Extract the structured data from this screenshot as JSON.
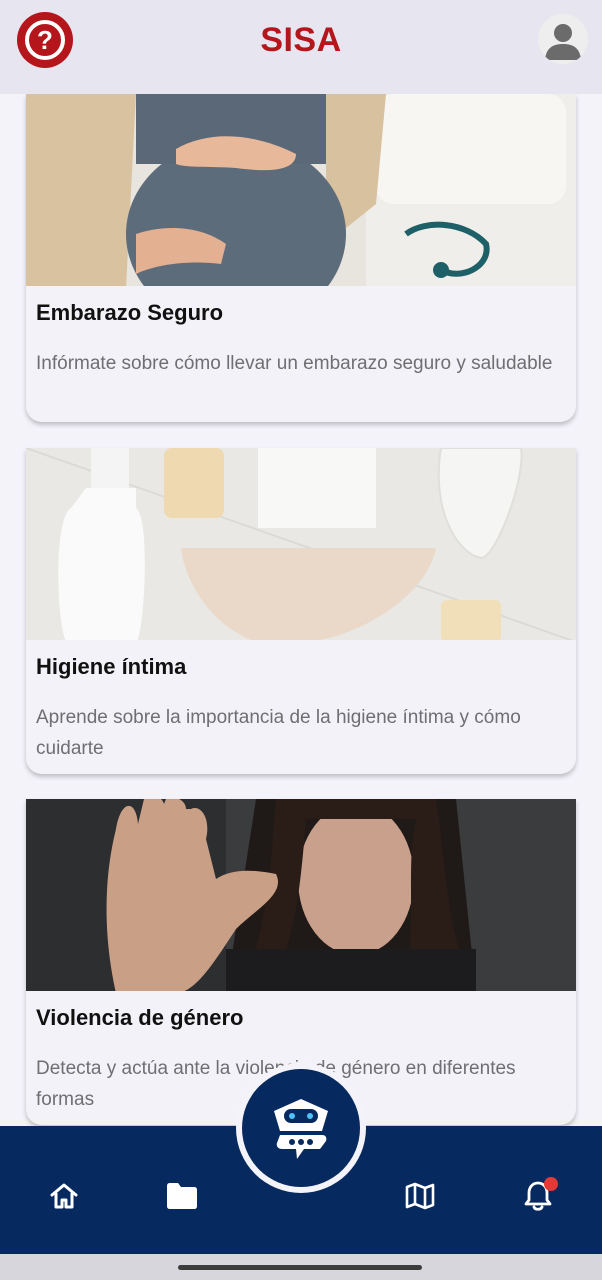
{
  "header": {
    "title": "SISA",
    "help_icon": "help-circle-icon",
    "profile_icon": "user-avatar-icon"
  },
  "cards": [
    {
      "title": "Embarazo Seguro",
      "description": "Infórmate sobre cómo llevar un embarazo seguro y saludable",
      "image": "pregnant-woman-photo"
    },
    {
      "title": "Higiene íntima",
      "description": "Aprende sobre la importancia de la higiene íntima y cómo cuidarte",
      "image": "hygiene-products-photo"
    },
    {
      "title": "Violencia de género",
      "description": "Detecta y actúa ante la violencia de género en diferentes formas",
      "image": "woman-stop-gesture-photo"
    }
  ],
  "bottom_nav": {
    "items": [
      "home-icon",
      "folder-icon",
      "chatbot-icon",
      "map-icon",
      "bell-icon"
    ],
    "has_notification": true
  },
  "colors": {
    "brand_red": "#b5161b",
    "nav_blue": "#06295f",
    "notification": "#e53935"
  }
}
